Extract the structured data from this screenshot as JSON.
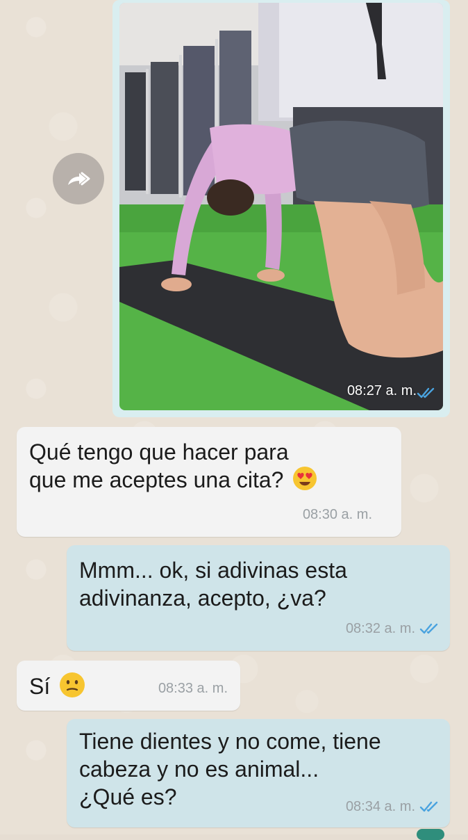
{
  "photo_message": {
    "time": "08:27 a. m.",
    "status": "read"
  },
  "messages": [
    {
      "direction": "incoming",
      "text": "Qué tengo que hacer para\nque me aceptes una cita?",
      "emoji": "heart-eyes-emoji",
      "time": "08:30 a. m."
    },
    {
      "direction": "outgoing",
      "text": "Mmm... ok, si adivinas esta\nadivinanza, acepto, ¿va?",
      "time": "08:32 a. m.",
      "status": "read"
    },
    {
      "direction": "incoming",
      "text": "Sí",
      "emoji": "neutral-face-emoji",
      "time": "08:33 a. m."
    },
    {
      "direction": "outgoing",
      "text": "Tiene dientes y no come, tiene\ncabeza y no es animal...\n¿Qué es?",
      "time": "08:34 a. m.",
      "status": "read"
    }
  ],
  "colors": {
    "chat_background": "#e9e1d6",
    "incoming_bubble": "#f3f3f3",
    "outgoing_bubble": "#cfe4e9",
    "read_ticks": "#4aa3df",
    "timestamp": "#9aa0a4"
  },
  "icons": {
    "forward": "forward-arrow-icon",
    "read_receipt": "double-check-icon"
  }
}
